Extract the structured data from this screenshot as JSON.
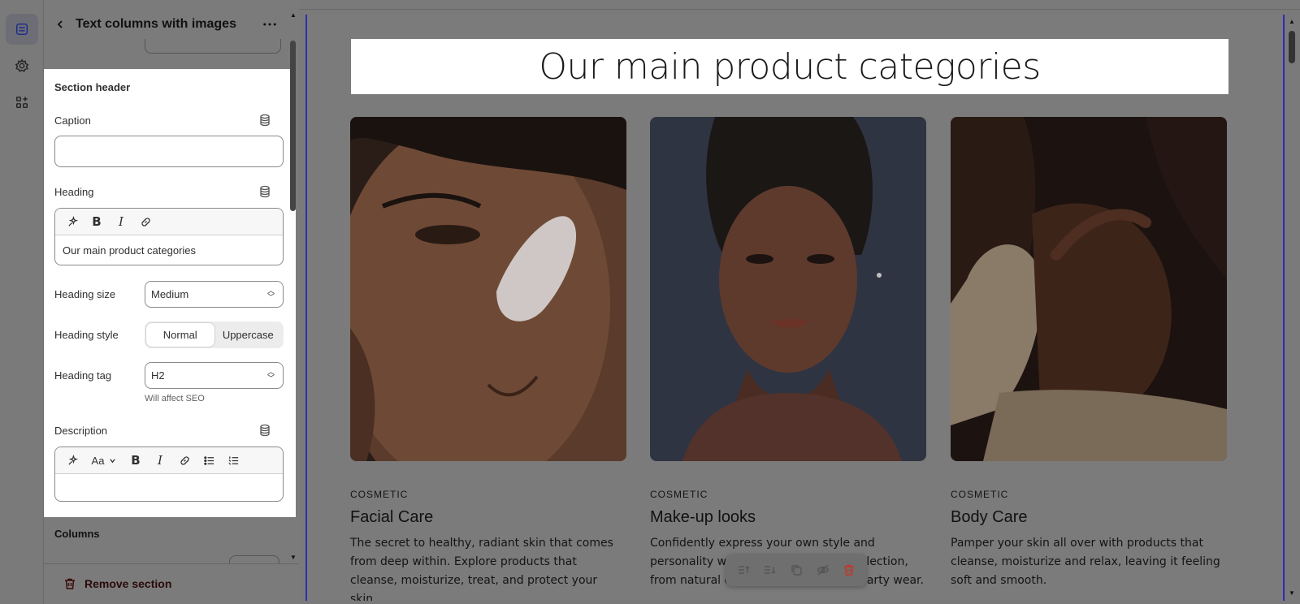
{
  "panel": {
    "title": "Text columns with images",
    "section_header_label": "Section header",
    "caption": {
      "label": "Caption",
      "value": ""
    },
    "heading": {
      "label": "Heading",
      "value": "Our main product categories"
    },
    "heading_size": {
      "label": "Heading size",
      "value": "Medium"
    },
    "heading_style": {
      "label": "Heading style",
      "options": [
        "Normal",
        "Uppercase"
      ],
      "selected": "Normal"
    },
    "heading_tag": {
      "label": "Heading tag",
      "value": "H2",
      "hint": "Will affect SEO"
    },
    "description": {
      "label": "Description",
      "value": "",
      "font_button": "Aa"
    },
    "columns_label": "Columns",
    "remove_label": "Remove section"
  },
  "preview": {
    "heading": "Our main product categories",
    "columns": [
      {
        "caption": "COSMETIC",
        "title": "Facial Care",
        "description": "The secret to healthy, radiant skin that comes from deep within. Explore products that cleanse, moisturize, treat, and protect your skin."
      },
      {
        "caption": "COSMETIC",
        "title": "Make-up looks",
        "description": "Confidently express your own style and personality with a diverse makeup collection, from natural everyday to glamorous party wear."
      },
      {
        "caption": "COSMETIC",
        "title": "Body Care",
        "description": "Pamper your skin all over with products that cleanse, moisturize and relax, leaving it feeling soft and smooth."
      }
    ]
  },
  "colors": {
    "selection_outline": "#2b2fb0",
    "delete_red": "#c0392b",
    "overlay": "#7a7a7a"
  }
}
